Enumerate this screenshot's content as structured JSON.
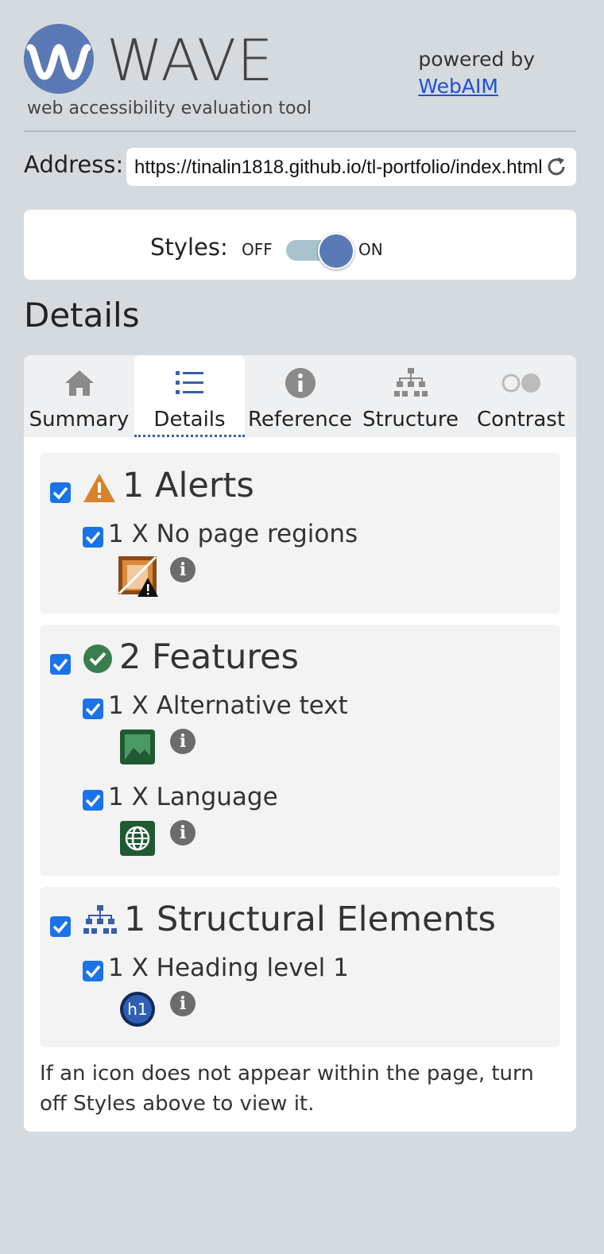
{
  "header": {
    "logo_title": "WAVE",
    "logo_subtitle": "web accessibility evaluation tool",
    "powered_by": "powered by",
    "webaim_link": "WebAIM"
  },
  "address": {
    "label": "Address:",
    "value": "https://tinalin1818.github.io/tl-portfolio/index.html"
  },
  "styles": {
    "label": "Styles:",
    "off": "OFF",
    "on": "ON",
    "state": "on"
  },
  "section_title": "Details",
  "tabs": [
    {
      "label": "Summary",
      "icon": "home-icon"
    },
    {
      "label": "Details",
      "icon": "list-icon",
      "active": true
    },
    {
      "label": "Reference",
      "icon": "info-icon"
    },
    {
      "label": "Structure",
      "icon": "sitemap-icon"
    },
    {
      "label": "Contrast",
      "icon": "contrast-icon"
    }
  ],
  "groups": {
    "alerts": {
      "title": "1 Alerts",
      "items": [
        {
          "text": "1 X No page regions",
          "icon": "no-page-regions-icon"
        }
      ]
    },
    "features": {
      "title": "2 Features",
      "items": [
        {
          "text": "1 X Alternative text",
          "icon": "alternative-text-icon"
        },
        {
          "text": "1 X Language",
          "icon": "language-icon"
        }
      ]
    },
    "structure": {
      "title": "1 Structural Elements",
      "items": [
        {
          "text": "1 X Heading level 1",
          "icon": "heading-level-1-icon",
          "badge_text": "h1"
        }
      ]
    }
  },
  "note": "If an icon does not appear within the page, turn off Styles above to view it.",
  "colors": {
    "background": "#d5dadf",
    "accent": "#5a79b5",
    "checkbox": "#1a73e8",
    "alert": "#d9822b",
    "feature": "#3a7d4f",
    "link": "#1e4fd6"
  }
}
